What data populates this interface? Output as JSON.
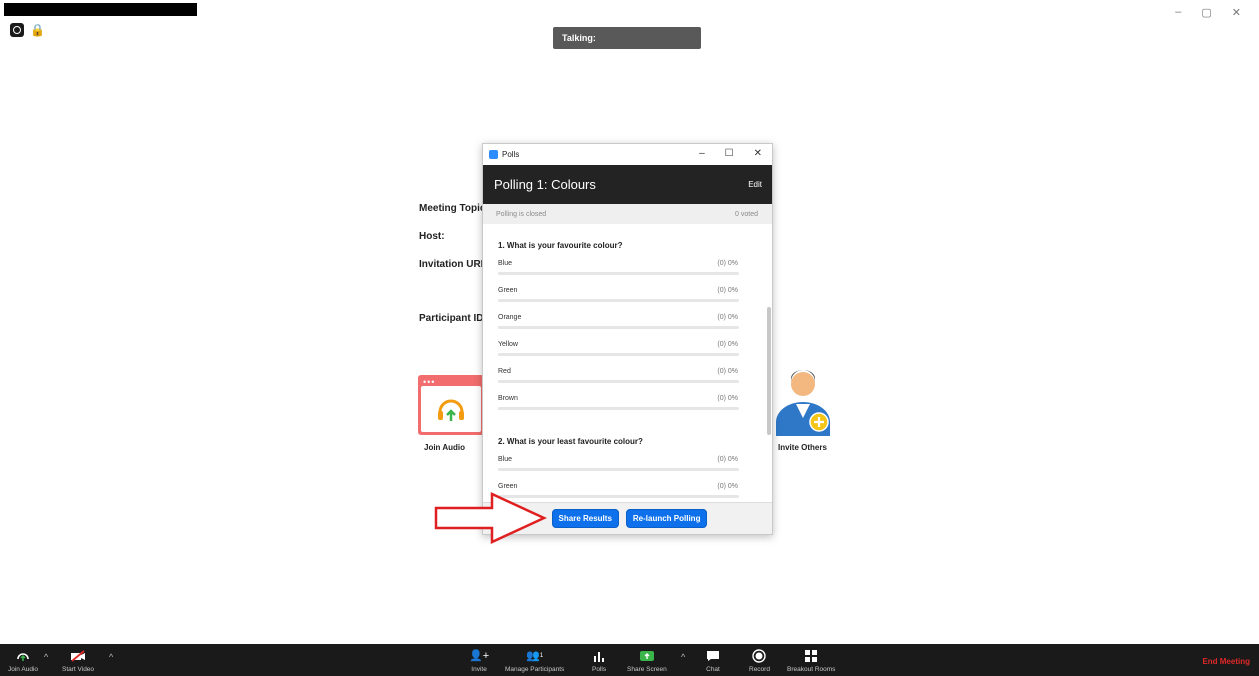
{
  "window": {
    "controls": [
      "–",
      "▢",
      "✕"
    ]
  },
  "talking": {
    "label": "Talking:"
  },
  "background": {
    "meeting_topic": "Meeting Topic",
    "host": "Host:",
    "invitation_url": "Invitation URL",
    "participant_id": "Participant ID",
    "join_audio": "Join Audio",
    "invite_others": "Invite Others"
  },
  "polls": {
    "window_title": "Polls",
    "poll_title": "Polling 1: Colours",
    "edit_label": "Edit",
    "status": "Polling is closed",
    "voted": "0 voted",
    "questions": [
      {
        "title": "1. What is your favourite colour?",
        "options": [
          {
            "label": "Blue",
            "result": "(0) 0%",
            "fraction": 0
          },
          {
            "label": "Green",
            "result": "(0) 0%",
            "fraction": 0
          },
          {
            "label": "Orange",
            "result": "(0) 0%",
            "fraction": 0
          },
          {
            "label": "Yellow",
            "result": "(0) 0%",
            "fraction": 0
          },
          {
            "label": "Red",
            "result": "(0) 0%",
            "fraction": 0
          },
          {
            "label": "Brown",
            "result": "(0) 0%",
            "fraction": 0
          }
        ]
      },
      {
        "title": "2. What is your least favourite colour?",
        "options": [
          {
            "label": "Blue",
            "result": "(0) 0%",
            "fraction": 0
          },
          {
            "label": "Green",
            "result": "(0) 0%",
            "fraction": 0
          }
        ]
      }
    ],
    "share_results": "Share Results",
    "relaunch": "Re-launch Polling"
  },
  "toolbar": {
    "join_audio": "Join Audio",
    "start_video": "Start Video",
    "invite": "Invite",
    "manage_participants": "Manage Participants",
    "participant_count": "1",
    "polls": "Polls",
    "share_screen": "Share Screen",
    "chat": "Chat",
    "record": "Record",
    "breakout_rooms": "Breakout Rooms",
    "end_meeting": "End Meeting"
  },
  "colors": {
    "accent": "#0e71eb",
    "end_meeting": "#e02828",
    "share_screen": "#3ab54a",
    "join_audio_card": "#f26d6d"
  }
}
